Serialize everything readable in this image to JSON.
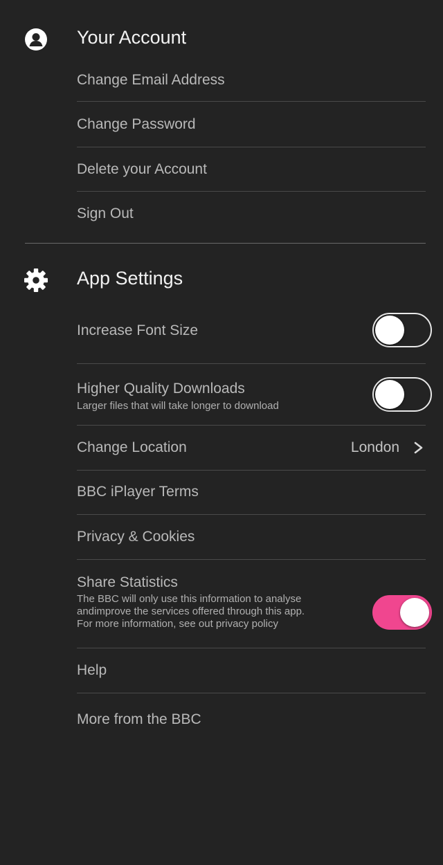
{
  "account": {
    "title": "Your Account",
    "icon": "user-icon",
    "items": [
      {
        "label": "Change Email Address"
      },
      {
        "label": "Change Password"
      },
      {
        "label": "Delete your Account"
      },
      {
        "label": "Sign Out"
      }
    ]
  },
  "settings": {
    "title": "App Settings",
    "icon": "gear-icon",
    "font_size": {
      "label": "Increase Font Size",
      "enabled": false
    },
    "hq_downloads": {
      "label": "Higher Quality Downloads",
      "sublabel": "Larger files that will take longer to download",
      "enabled": false
    },
    "location": {
      "label": "Change Location",
      "value": "London"
    },
    "terms": {
      "label": "BBC iPlayer Terms"
    },
    "privacy": {
      "label": "Privacy & Cookies"
    },
    "statistics": {
      "label": "Share Statistics",
      "sublabel_lines": [
        "The BBC will only use this information to analyse",
        "andimprove the services offered through this app.",
        "For more information, see out privacy policy"
      ],
      "enabled": true
    },
    "help": {
      "label": "Help"
    },
    "more": {
      "label": "More from the BBC"
    }
  },
  "colors": {
    "background": "#232323",
    "toggle_on": "#f0468f",
    "toggle_off_border": "#e8e8e8",
    "title_text": "#f2f2f2",
    "row_text": "#b9b9b9"
  }
}
